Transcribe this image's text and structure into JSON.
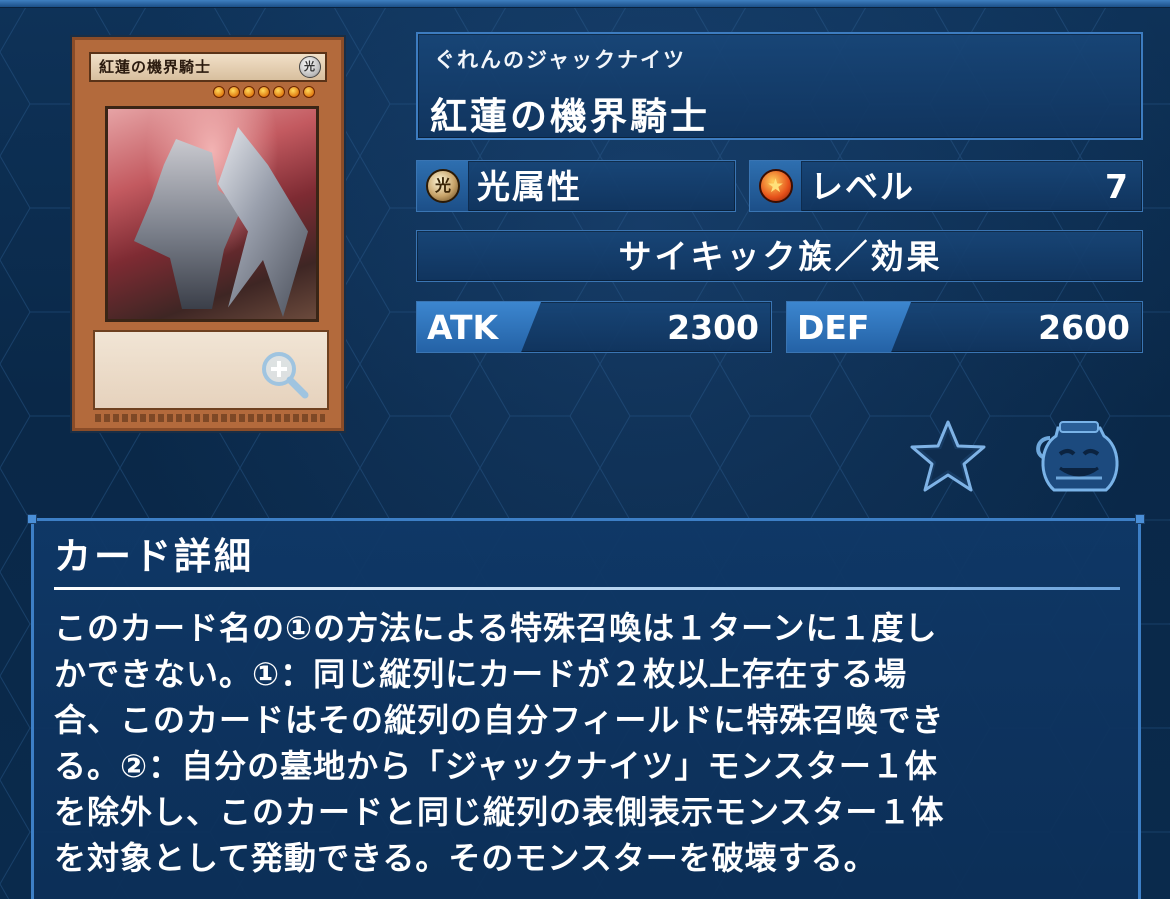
{
  "card": {
    "ruby": "ぐれんのジャックナイツ",
    "name": "紅蓮の機界騎士",
    "art_name": "紅蓮の機界騎士",
    "art_attr_glyph": "光",
    "attribute": "光属性",
    "attribute_glyph": "光",
    "level_label": "レベル",
    "level_value": "7",
    "type_line": "サイキック族／効果",
    "atk_label": "ATK",
    "atk_value": "2300",
    "def_label": "DEF",
    "def_value": "2600"
  },
  "icons": {
    "zoom": "zoom-in-icon",
    "favorite": "star-icon",
    "pot": "pot-of-greed-icon"
  },
  "detail": {
    "heading": "カード詳細",
    "text": "このカード名の①の方法による特殊召喚は１ターンに１度し\nかできない。①：同じ縦列にカードが２枚以上存在する場\n合、このカードはその縦列の自分フィールドに特殊召喚でき\nる。②：自分の墓地から「ジャックナイツ」モンスター１体\nを除外し、このカードと同じ縦列の表側表示モンスター１体\nを対象として発動できる。そのモンスターを破壊する。"
  },
  "colors": {
    "background": "#0b2a4c",
    "panel_border": "#3d7cc0",
    "stat_tag": "#2f73bb"
  }
}
